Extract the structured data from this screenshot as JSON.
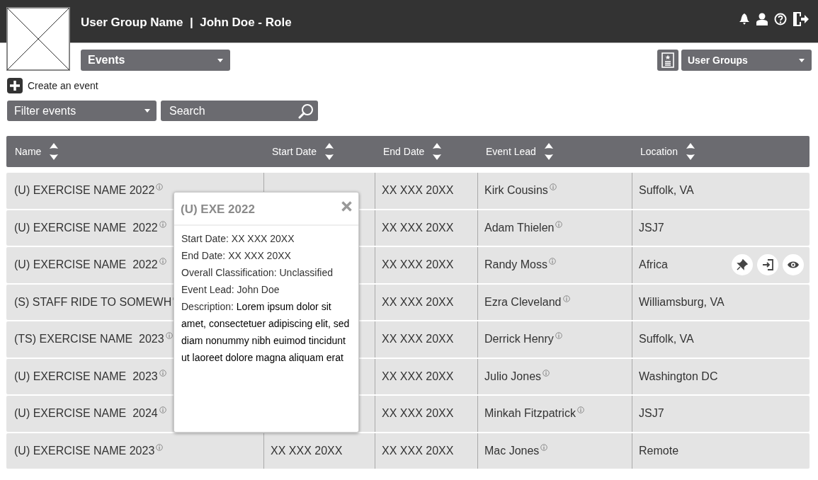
{
  "header": {
    "title": "User Group Name  |  John Doe - Role"
  },
  "event_menu": {
    "label": "Events"
  },
  "user_groups_menu": {
    "label": "User Groups"
  },
  "create_link": {
    "label": "Create an event"
  },
  "filter": {
    "label": "Filter events"
  },
  "search": {
    "placeholder": "Search"
  },
  "table": {
    "columns": [
      "Name",
      "Start Date",
      "End Date",
      "Event Lead",
      "Location"
    ],
    "rows": [
      {
        "name": "(U) EXERCISE NAME 2022",
        "end_date": "XX XXX 20XX",
        "event_lead": "Kirk Cousins",
        "location": "Suffolk, VA",
        "show_actions": false
      },
      {
        "name": "(U) EXERCISE NAME  2022",
        "end_date": "XX XXX 20XX",
        "event_lead": "Adam Thielen",
        "location": "JSJ7",
        "show_actions": false
      },
      {
        "name": "(U) EXERCISE NAME  2022",
        "end_date": "XX XXX 20XX",
        "event_lead": "Randy Moss",
        "location": "Africa",
        "show_actions": true
      },
      {
        "name": "(S) STAFF RIDE TO SOMEWH",
        "end_date": "XX XXX 20XX",
        "event_lead": "Ezra Cleveland",
        "location": "Williamsburg, VA",
        "show_actions": false
      },
      {
        "name": "(TS) EXERCISE NAME  2023",
        "end_date": "XX XXX 20XX",
        "event_lead": "Derrick Henry",
        "location": "Suffolk, VA",
        "show_actions": false
      },
      {
        "name": "(U) EXERCISE NAME  2023",
        "end_date": "XX XXX 20XX",
        "event_lead": "Julio Jones",
        "location": "Washington DC",
        "show_actions": false
      },
      {
        "name": "(U) EXERCISE NAME  2024",
        "end_date": "XX XXX 20XX",
        "event_lead": "Minkah Fitzpatrick",
        "location": "JSJ7",
        "show_actions": false
      },
      {
        "name": "(U) EXERCISE NAME 2023",
        "start_date": "XX XXX 20XX",
        "end_date": "XX XXX 20XX",
        "event_lead": "Mac Jones",
        "location": "Remote",
        "show_actions": false
      }
    ]
  },
  "popover": {
    "title": "(U) EXE 2022",
    "details": [
      "Start Date: XX XXX 20XX",
      "End Date: XX XXX 20XX",
      "Overall Classification: Unclassified",
      "Event Lead: John Doe"
    ],
    "description_label": "Description:",
    "description": "Lorem ipsum dolor sit amet, consectetuer adipiscing elit, sed diam nonummy nibh euimod tincidunt ut laoreet dolore magna aliquam erat"
  }
}
